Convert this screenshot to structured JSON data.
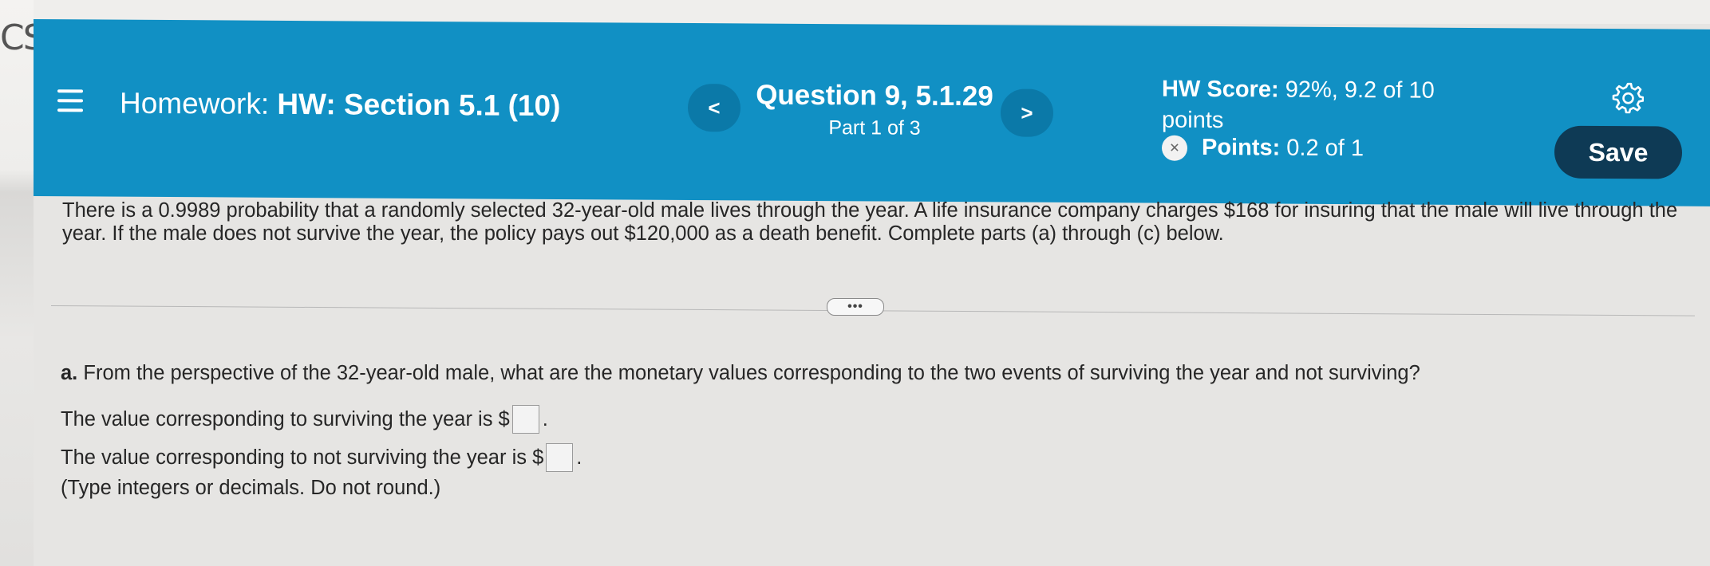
{
  "side_mark": "CS",
  "header": {
    "homework_prefix": "Homework:",
    "homework_title": "HW: Section 5.1 (10)",
    "prev_label": "<",
    "next_label": ">",
    "question_title": "Question 9, 5.1.29",
    "question_part": "Part 1 of 3",
    "hw_score_label": "HW Score:",
    "hw_score_value": "92%, 9.2 of 10",
    "hw_score_unit": "points",
    "points_label": "Points:",
    "points_value": "0.2 of 1",
    "save_label": "Save"
  },
  "problem": {
    "statement": "There is a 0.9989 probability that a randomly selected 32-year-old male lives through the year. A life insurance company charges $168 for insuring that the male will live through the year. If the male does not survive the year, the policy pays out $120,000 as a death benefit. Complete parts (a) through (c) below."
  },
  "expand_label": "•••",
  "part_a": {
    "letter": "a.",
    "question": "From the perspective of the 32-year-old male, what are the monetary values corresponding to the two events of surviving the year and not surviving?",
    "line1_prefix": "The value corresponding to surviving the year is $",
    "line1_suffix": ".",
    "line1_value": "",
    "line2_prefix": "The value corresponding to not surviving the year is $",
    "line2_suffix": ".",
    "line2_value": "",
    "hint": "(Type integers or decimals. Do not round.)"
  },
  "colors": {
    "header_bg": "#1190c4",
    "save_bg": "#0e3a55",
    "page_bg": "#e6e5e3"
  },
  "icons": [
    "menu-icon",
    "chevron-left-icon",
    "chevron-right-icon",
    "partial-credit-icon",
    "gear-icon"
  ]
}
